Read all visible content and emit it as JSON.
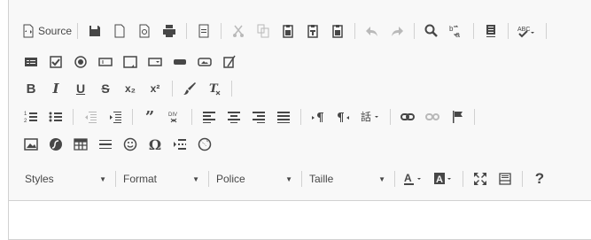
{
  "toolbar": {
    "source_label": "Source",
    "combos": [
      {
        "label": "Styles"
      },
      {
        "label": "Format"
      },
      {
        "label": "Police"
      },
      {
        "label": "Taille"
      }
    ],
    "bold": "B",
    "italic": "I",
    "underline": "U",
    "strike": "S",
    "sub": "x₂",
    "sup": "x²",
    "help": "?"
  },
  "colors": {
    "icon": "#474747",
    "disabled": "#b9b9b9",
    "border": "#d1d1d1",
    "toolbar_bg": "#f8f8f8"
  }
}
